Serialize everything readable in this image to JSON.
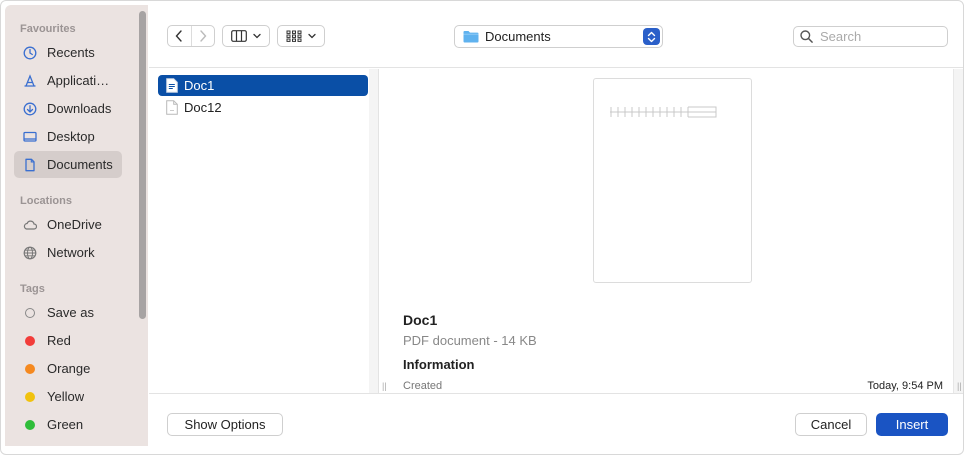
{
  "sidebar": {
    "sections": [
      {
        "title": "Favourites"
      },
      {
        "title": "Locations"
      },
      {
        "title": "Tags"
      }
    ],
    "favourites": [
      {
        "label": "Recents",
        "icon": "clock-icon"
      },
      {
        "label": "Applicati…",
        "icon": "applications-icon"
      },
      {
        "label": "Downloads",
        "icon": "download-icon"
      },
      {
        "label": "Desktop",
        "icon": "desktop-icon"
      },
      {
        "label": "Documents",
        "icon": "document-icon",
        "active": true
      }
    ],
    "locations": [
      {
        "label": "OneDrive",
        "icon": "cloud-icon"
      },
      {
        "label": "Network",
        "icon": "globe-icon"
      }
    ],
    "tags": [
      {
        "label": "Save as",
        "color": ""
      },
      {
        "label": "Red",
        "color": "#f23d3a"
      },
      {
        "label": "Orange",
        "color": "#f5891f"
      },
      {
        "label": "Yellow",
        "color": "#f1c20e"
      },
      {
        "label": "Green",
        "color": "#2fbd3a"
      }
    ]
  },
  "toolbar": {
    "location": "Documents",
    "search_placeholder": "Search"
  },
  "files": [
    {
      "name": "Doc1",
      "selected": true
    },
    {
      "name": "Doc12",
      "selected": false
    }
  ],
  "preview": {
    "name": "Doc1",
    "kind": "PDF document - 14 KB",
    "info_heading": "Information",
    "created_label": "Created",
    "created_value": "Today, 9:54 PM"
  },
  "buttons": {
    "show_options": "Show Options",
    "cancel": "Cancel",
    "insert": "Insert"
  },
  "colors": {
    "accent": "#1a54c3",
    "selection": "#0a4fa6",
    "sidebar_bg": "#ebe3e1"
  }
}
